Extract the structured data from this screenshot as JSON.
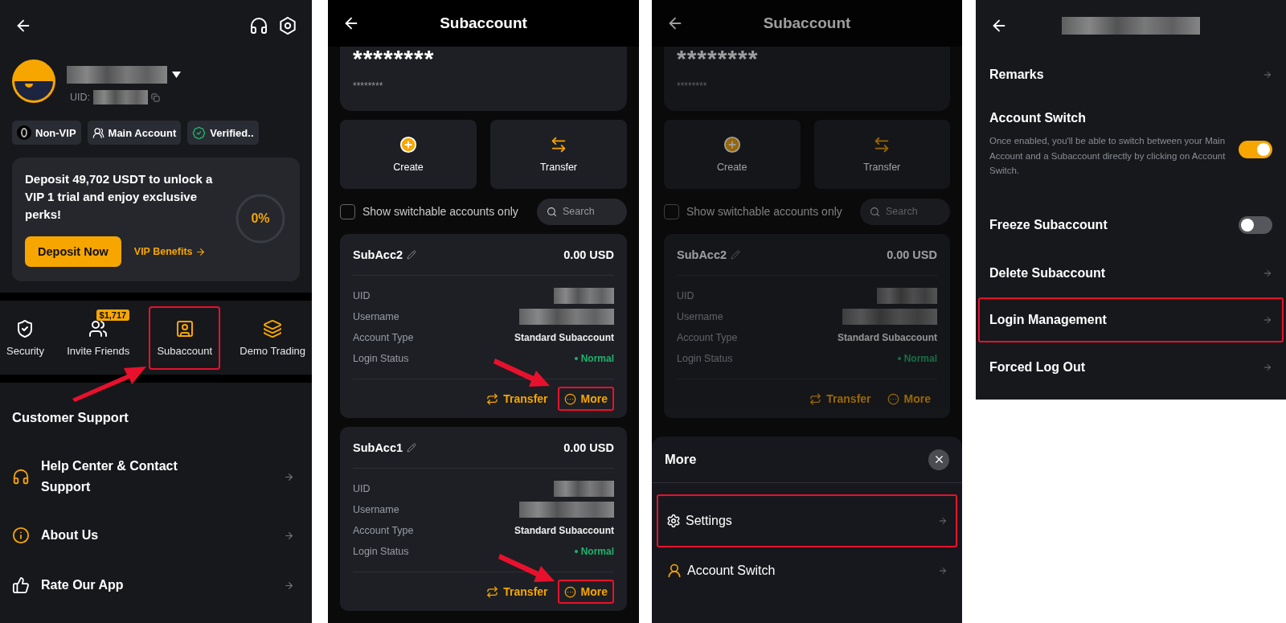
{
  "profile_screen": {
    "profile": {
      "uid_label": "UID:"
    },
    "chips": [
      {
        "kind": "vip",
        "label": "Non-VIP"
      },
      {
        "kind": "account",
        "label": "Main Account"
      },
      {
        "kind": "verified",
        "label": "Verified.."
      }
    ],
    "vip_card": {
      "message": "Deposit 49,702 USDT to unlock a VIP 1 trial and enjoy exclusive perks!",
      "progress": "0%",
      "level": 0,
      "primary_button": "Deposit Now",
      "link": "VIP Benefits"
    },
    "shortcuts": [
      {
        "kind": "security",
        "label": "Security",
        "highlighted": false
      },
      {
        "kind": "invite",
        "label": "Invite Friends",
        "badge": "$1,717",
        "highlighted": false
      },
      {
        "kind": "subaccount",
        "label": "Subaccount",
        "highlighted": true
      },
      {
        "kind": "demo",
        "label": "Demo Trading",
        "highlighted": false
      }
    ],
    "section_title": "Customer Support",
    "menu_items": [
      {
        "kind": "headset",
        "label": "Help Center & Contact Support"
      },
      {
        "kind": "info",
        "label": "About Us"
      },
      {
        "kind": "thumb",
        "label": "Rate Our App"
      }
    ]
  },
  "subaccount_screen": {
    "title": "Subaccount",
    "balance_masked": "********",
    "balance_sub_masked": "********",
    "actions": [
      {
        "kind": "create",
        "label": "Create"
      },
      {
        "kind": "transfer",
        "label": "Transfer"
      }
    ],
    "filter": {
      "label": "Show switchable accounts only",
      "checked": false
    },
    "search": {
      "placeholder": "Search"
    },
    "accounts": [
      {
        "name": "SubAcc2",
        "balance": "0.00 USD",
        "fields": [
          {
            "kind": "redacted",
            "label": "UID"
          },
          {
            "kind": "redacted",
            "label": "Username"
          },
          {
            "kind": "text",
            "label": "Account Type",
            "value": "Standard Subaccount"
          },
          {
            "kind": "status",
            "label": "Login Status",
            "value": "Normal"
          }
        ],
        "actions": [
          {
            "kind": "transfer",
            "label": "Transfer",
            "highlighted": false
          },
          {
            "kind": "more",
            "label": "More",
            "highlighted": true
          }
        ]
      },
      {
        "name": "SubAcc1",
        "balance": "0.00 USD",
        "fields": [
          {
            "kind": "redacted",
            "label": "UID"
          },
          {
            "kind": "redacted",
            "label": "Username"
          },
          {
            "kind": "text",
            "label": "Account Type",
            "value": "Standard Subaccount"
          },
          {
            "kind": "status",
            "label": "Login Status",
            "value": "Normal"
          }
        ],
        "actions": [
          {
            "kind": "transfer",
            "label": "Transfer",
            "highlighted": false
          },
          {
            "kind": "more",
            "label": "More",
            "highlighted": true
          }
        ]
      }
    ]
  },
  "more_sheet_screen": {
    "background": {
      "title": "Subaccount",
      "balance_masked": "********",
      "balance_sub_masked": "********",
      "actions": [
        {
          "kind": "create",
          "label": "Create"
        },
        {
          "kind": "transfer",
          "label": "Transfer"
        }
      ],
      "filter": {
        "label": "Show switchable accounts only",
        "checked": false
      },
      "search": {
        "placeholder": "Search"
      },
      "accounts": [
        {
          "name": "SubAcc2",
          "balance": "0.00 USD",
          "fields": [
            {
              "kind": "redacted",
              "label": "UID"
            },
            {
              "kind": "redacted",
              "label": "Username"
            },
            {
              "kind": "text",
              "label": "Account Type",
              "value": "Standard Subaccount"
            },
            {
              "kind": "status",
              "label": "Login Status",
              "value": "Normal"
            }
          ],
          "actions": [
            {
              "kind": "transfer",
              "label": "Transfer",
              "highlighted": false
            },
            {
              "kind": "more",
              "label": "More",
              "highlighted": false
            }
          ]
        }
      ]
    },
    "sheet": {
      "title": "More",
      "items": [
        {
          "kind": "settings",
          "label": "Settings",
          "highlighted": true
        },
        {
          "kind": "switch",
          "label": "Account Switch",
          "highlighted": false
        }
      ]
    }
  },
  "settings_screen": {
    "items": [
      {
        "kind": "link",
        "label": "Remarks",
        "highlighted": false
      },
      {
        "kind": "toggle",
        "label": "Account Switch",
        "on": true,
        "description": "Once enabled, you'll be able to switch between your Main Account and a Subaccount directly by clicking on Account Switch."
      },
      {
        "kind": "toggle",
        "label": "Freeze Subaccount",
        "on": false
      },
      {
        "kind": "link",
        "label": "Delete Subaccount",
        "highlighted": false
      },
      {
        "kind": "link",
        "label": "Login Management",
        "highlighted": true
      },
      {
        "kind": "link",
        "label": "Forced Log Out",
        "highlighted": false
      }
    ]
  }
}
